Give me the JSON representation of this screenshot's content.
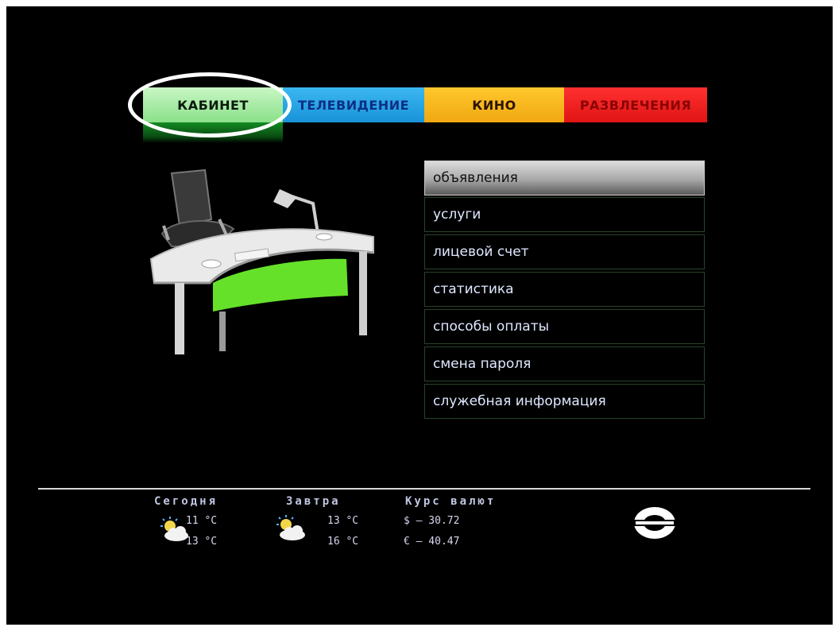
{
  "tabs": [
    {
      "label": "КАБИНЕТ",
      "color": "#9be996"
    },
    {
      "label": "ТЕЛЕВИДЕНИЕ",
      "color": "#2aa6ea"
    },
    {
      "label": "КИНО",
      "color": "#f7b520"
    },
    {
      "label": "РАЗВЛЕЧЕНИЯ",
      "color": "#ee2020"
    }
  ],
  "menu": {
    "items": [
      "объявления",
      "услуги",
      "лицевой счет",
      "статистика",
      "способы оплаты",
      "смена пароля",
      "служебная информация"
    ],
    "selected": "объявления"
  },
  "footer": {
    "today": {
      "title": "Сегодня",
      "temp1": "11 °C",
      "temp2": "13 °C",
      "icon": "partly-cloudy-icon"
    },
    "tomorrow": {
      "title": "Завтра",
      "temp1": "13 °C",
      "temp2": "16 °C",
      "icon": "partly-cloudy-icon"
    },
    "currency": {
      "title": "Курс валют",
      "usd": "$ – 30.72",
      "eur": "€ – 40.47"
    },
    "logo": "provider-logo"
  },
  "illustration": "office-desk-image"
}
